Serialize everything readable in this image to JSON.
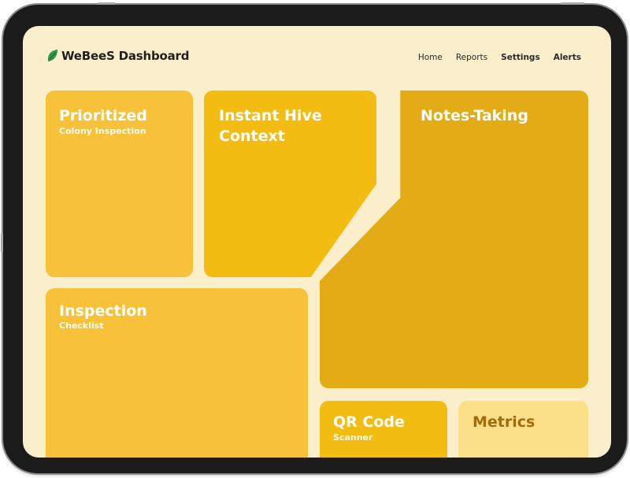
{
  "app": {
    "brand": "WeBeeS Dashboard"
  },
  "nav": {
    "items": [
      "Home",
      "Reports",
      "Settings",
      "Alerts"
    ]
  },
  "cards": {
    "prioritized": {
      "title": "Prioritized",
      "subtitle": "Colony Inspection"
    },
    "hive": {
      "title": "Instant Hive\nContext"
    },
    "notes": {
      "title": "Notes-Taking"
    },
    "inspection": {
      "title": "Inspection",
      "subtitle": "Checklist"
    },
    "qr": {
      "title": "QR Code",
      "subtitle": "Scanner"
    },
    "metrics": {
      "title": "Metrics"
    }
  },
  "colors": {
    "background": "#fbeecb",
    "card_light": "#f7c23a",
    "card_mid": "#f3bc10",
    "card_dark": "#e3ab16",
    "card_pale": "#fbe089",
    "logo_green": "#2e9a4a"
  },
  "icons": {
    "logo": "leaf-icon"
  }
}
